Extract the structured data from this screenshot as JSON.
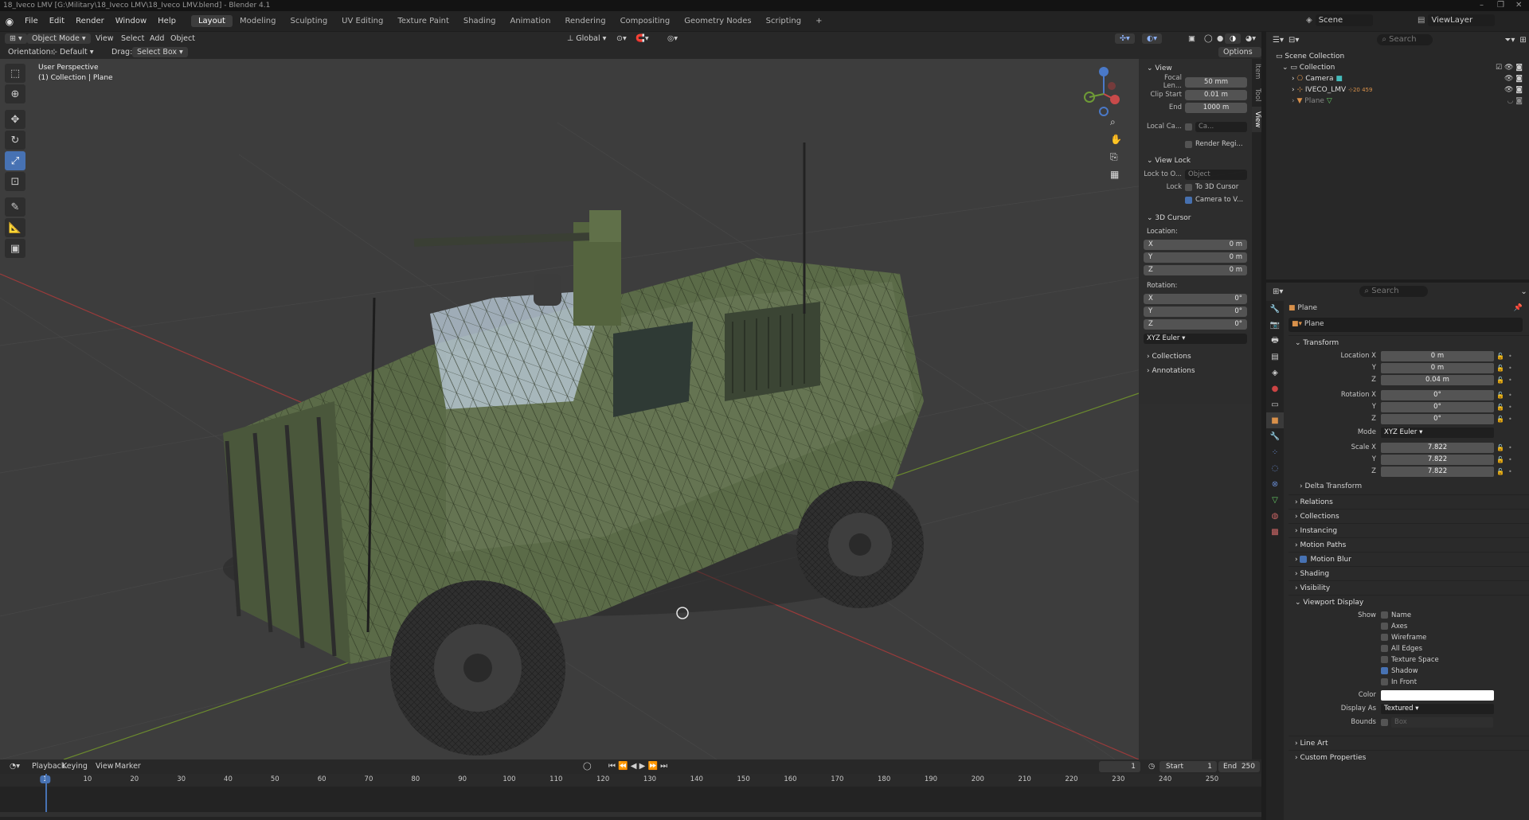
{
  "window": {
    "title": "18_Iveco LMV [G:\\Military\\18_Iveco LMV\\18_Iveco LMV.blend] - Blender 4.1"
  },
  "menu": [
    "File",
    "Edit",
    "Render",
    "Window",
    "Help"
  ],
  "workspaces": [
    "Layout",
    "Modeling",
    "Sculpting",
    "UV Editing",
    "Texture Paint",
    "Shading",
    "Animation",
    "Rendering",
    "Compositing",
    "Geometry Nodes",
    "Scripting"
  ],
  "active_workspace": "Layout",
  "topright": {
    "scene": "Scene",
    "view_layer": "ViewLayer"
  },
  "viewport_header": {
    "mode": "Object Mode",
    "menus": [
      "View",
      "Select",
      "Add",
      "Object"
    ],
    "transform": "Global",
    "options": "Options"
  },
  "viewport_header2": {
    "orientation_label": "Orientation:",
    "orientation": "Default",
    "drag_label": "Drag:",
    "drag": "Select Box"
  },
  "viewport": {
    "perspective": "User Perspective",
    "context": "(1) Collection | Plane"
  },
  "npanel": {
    "tabs": [
      "Item",
      "Tool",
      "View"
    ],
    "view_title": "View",
    "focal_label": "Focal Len...",
    "focal": "50 mm",
    "clip_start_label": "Clip Start",
    "clip_start": "0.01 m",
    "clip_end_label": "End",
    "clip_end": "1000 m",
    "local_camera_label": "Local Ca...",
    "local_camera": "Ca...",
    "render_region": "Render Regi...",
    "view_lock_title": "View Lock",
    "lock_to_label": "Lock to O...",
    "lock_to_placeholder": "Object",
    "lock_label": "Lock",
    "to_3d_cursor": "To 3D Cursor",
    "camera_to_view": "Camera to V...",
    "cursor_title": "3D Cursor",
    "location_label": "Location:",
    "loc": [
      {
        "axis": "X",
        "value": "0 m"
      },
      {
        "axis": "Y",
        "value": "0 m"
      },
      {
        "axis": "Z",
        "value": "0 m"
      }
    ],
    "rotation_label": "Rotation:",
    "rot": [
      {
        "axis": "X",
        "value": "0°"
      },
      {
        "axis": "Y",
        "value": "0°"
      },
      {
        "axis": "Z",
        "value": "0°"
      }
    ],
    "rotation_mode": "XYZ Euler",
    "collections": "Collections",
    "annotations": "Annotations"
  },
  "outliner": {
    "search_placeholder": "Search",
    "items": [
      {
        "name": "Scene Collection"
      },
      {
        "name": "Collection"
      },
      {
        "name": "Camera"
      },
      {
        "name": "IVECO_LMV",
        "badge": "20 459"
      },
      {
        "name": "Plane"
      }
    ]
  },
  "properties": {
    "search_placeholder": "Search",
    "object_name": "Plane",
    "data_name": "Plane",
    "transform_title": "Transform",
    "location": [
      {
        "label": "Location X",
        "value": "0 m"
      },
      {
        "label": "Y",
        "value": "0 m"
      },
      {
        "label": "Z",
        "value": "0.04 m"
      }
    ],
    "rotation": [
      {
        "label": "Rotation X",
        "value": "0°"
      },
      {
        "label": "Y",
        "value": "0°"
      },
      {
        "label": "Z",
        "value": "0°"
      }
    ],
    "mode_label": "Mode",
    "mode": "XYZ Euler",
    "scale": [
      {
        "label": "Scale X",
        "value": "7.822"
      },
      {
        "label": "Y",
        "value": "7.822"
      },
      {
        "label": "Z",
        "value": "7.822"
      }
    ],
    "delta_transform": "Delta Transform",
    "sections": [
      "Relations",
      "Collections",
      "Instancing",
      "Motion Paths",
      "Motion Blur",
      "Shading",
      "Visibility"
    ],
    "viewport_display_title": "Viewport Display",
    "show_label": "Show",
    "show_options": [
      {
        "label": "Name",
        "checked": false
      },
      {
        "label": "Axes",
        "checked": false
      },
      {
        "label": "Wireframe",
        "checked": false
      },
      {
        "label": "All Edges",
        "checked": false
      },
      {
        "label": "Texture Space",
        "checked": false
      },
      {
        "label": "Shadow",
        "checked": true
      },
      {
        "label": "In Front",
        "checked": false
      }
    ],
    "color_label": "Color",
    "display_as_label": "Display As",
    "display_as": "Textured",
    "bounds_label": "Bounds",
    "bounds": "Box",
    "line_art": "Line Art",
    "custom_properties": "Custom Properties"
  },
  "timeline": {
    "menus": [
      "Playback",
      "Keying",
      "View",
      "Marker"
    ],
    "current_frame": "1",
    "start_label": "Start",
    "start": "1",
    "end_label": "End",
    "end": "250",
    "ticks": [
      "1",
      "10",
      "20",
      "30",
      "40",
      "50",
      "60",
      "70",
      "80",
      "90",
      "100",
      "110",
      "120",
      "130",
      "140",
      "150",
      "160",
      "170",
      "180",
      "190",
      "200",
      "210",
      "220",
      "230",
      "240",
      "250"
    ]
  },
  "colors": {
    "accent": "#4772b3",
    "vehicle": "#5b6b48",
    "grid_red": "#9b3b3b",
    "grid_green": "#6b8a2e"
  }
}
